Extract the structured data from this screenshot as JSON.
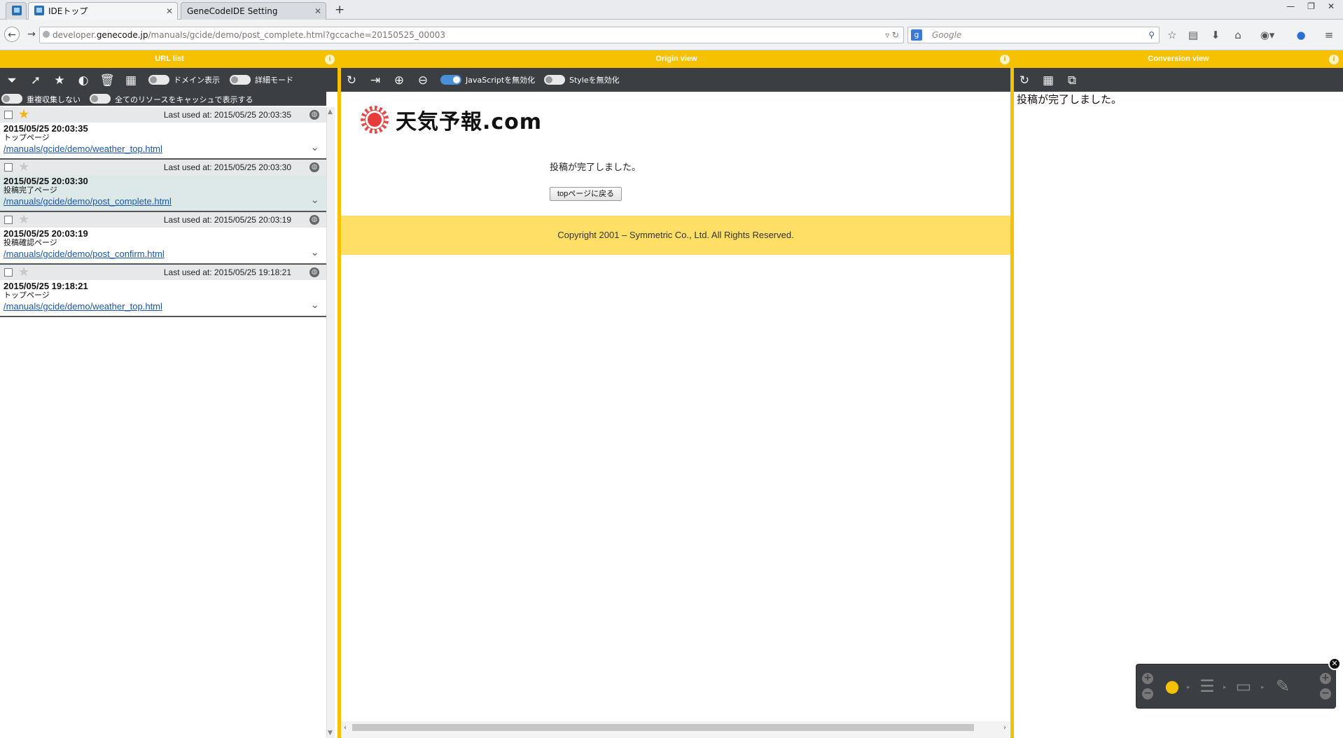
{
  "browser": {
    "tabs": [
      {
        "label": "IDEトップ",
        "active": true
      },
      {
        "label": "GeneCodeIDE Setting",
        "active": false
      }
    ],
    "new_tab": "+",
    "url": {
      "prefix": "developer.",
      "host": "genecode.jp",
      "path": "/manuals/gcide/demo/post_complete.html?gccache=20150525_00003"
    },
    "search_placeholder": "Google",
    "window_controls": [
      "—",
      "❐",
      "✕"
    ]
  },
  "panels": {
    "url_list": {
      "title": "URL list"
    },
    "origin_view": {
      "title": "Origin view"
    },
    "conversion_view": {
      "title": "Conversion view"
    }
  },
  "urllist_toolbar": {
    "domain_toggle_label": "ドメイン表示",
    "detail_toggle_label": "詳細モード",
    "dup_toggle_label": "重複収集しない",
    "cache_toggle_label": "全てのリソースをキャッシュで表示する"
  },
  "url_items": [
    {
      "starred": true,
      "last_used": "Last used at:  2015/05/25 20:03:35",
      "timestamp": "2015/05/25 20:03:35",
      "title": "トップページ",
      "path": "/manuals/gcide/demo/weather_top.html",
      "selected": false
    },
    {
      "starred": false,
      "last_used": "Last used at:  2015/05/25 20:03:30",
      "timestamp": "2015/05/25 20:03:30",
      "title": "投稿完了ページ",
      "path": "/manuals/gcide/demo/post_complete.html",
      "selected": true
    },
    {
      "starred": false,
      "last_used": "Last used at:  2015/05/25 20:03:19",
      "timestamp": "2015/05/25 20:03:19",
      "title": "投稿確認ページ",
      "path": "/manuals/gcide/demo/post_confirm.html",
      "selected": false
    },
    {
      "starred": false,
      "last_used": "Last used at:  2015/05/25 19:18:21",
      "timestamp": "2015/05/25 19:18:21",
      "title": "トップページ",
      "path": "/manuals/gcide/demo/weather_top.html",
      "selected": false
    }
  ],
  "origin_toolbar": {
    "js_toggle_label": "JavaScriptを無効化",
    "js_toggle_on": true,
    "style_toggle_label": "Styleを無効化",
    "style_toggle_on": false
  },
  "origin_page": {
    "logo_text": "天気予報.com",
    "message": "投稿が完了しました。",
    "back_button": "topページに戻る",
    "footer": "Copyright 2001 – Symmetric Co., Ltd. All Rights Reserved."
  },
  "conversion_page": {
    "message": "投稿が完了しました。"
  },
  "colors": {
    "accent": "#f6c200",
    "toolbar": "#3b3e43",
    "footer_bg": "#ffdf66",
    "star_on": "#f2b705",
    "link": "#1a57a8"
  }
}
